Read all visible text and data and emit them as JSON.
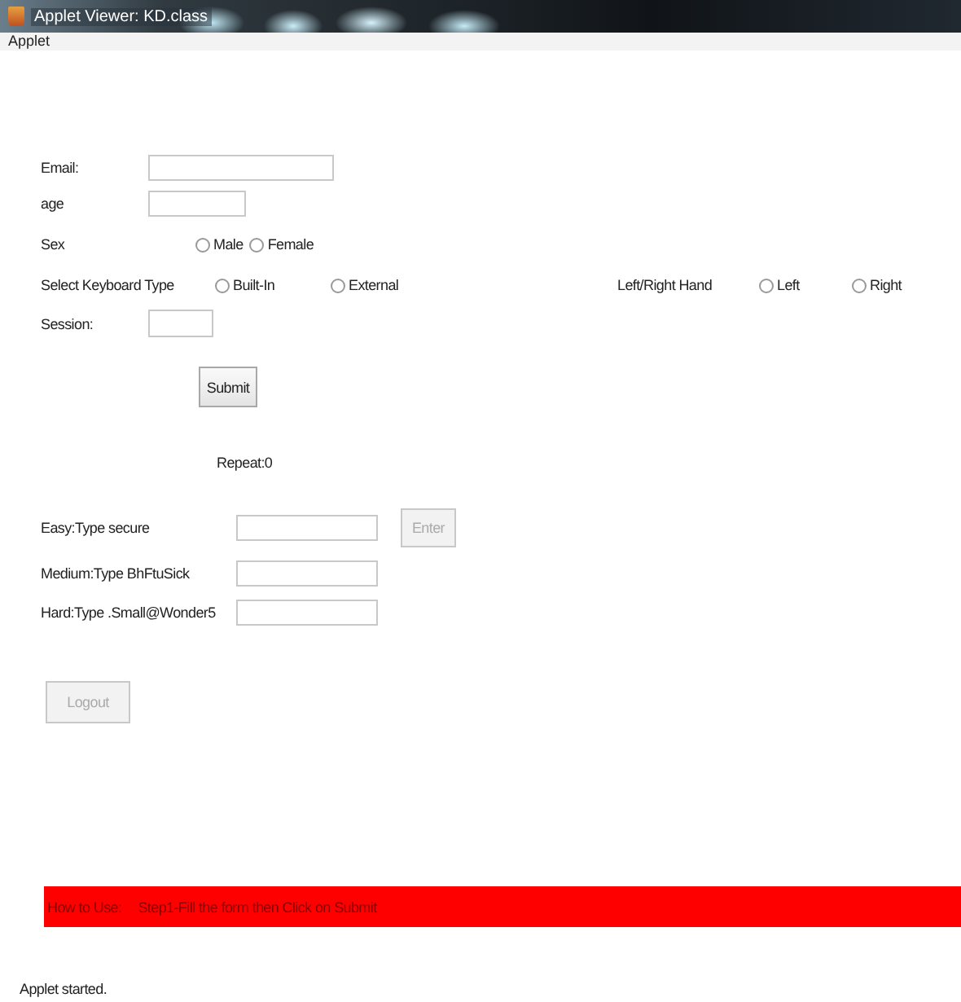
{
  "window": {
    "title": "Applet Viewer: KD.class"
  },
  "menu_bar": [
    "Applet"
  ],
  "form": {
    "email": {
      "label": "Email:"
    },
    "age": {
      "label": "age"
    },
    "sex": {
      "label": "Sex",
      "options": [
        {
          "label": "Male",
          "selected": false
        },
        {
          "label": "Female",
          "selected": false
        }
      ]
    },
    "keyboard": {
      "label": "Select Keyboard Type",
      "options": [
        {
          "label": "Built-In",
          "selected": false
        },
        {
          "label": "External",
          "selected": false
        }
      ]
    },
    "hand": {
      "label": "Left/Right Hand",
      "options": [
        {
          "label": "Left",
          "selected": false
        },
        {
          "label": "Right",
          "selected": false
        }
      ]
    },
    "session": {
      "label": "Session:"
    },
    "submit": {
      "label": "Submit",
      "disabled": false
    }
  },
  "repeat": "Repeat:0",
  "tests": [
    {
      "label": "Easy:Type  secure"
    },
    {
      "label": "Medium:Type  BhFtuSick"
    },
    {
      "label": "Hard:Type  .Small@Wonder5"
    }
  ],
  "enter_button": {
    "label": "Enter",
    "disabled": true
  },
  "logout_button": {
    "label": "Logout",
    "disabled": true
  },
  "help_bar": {
    "heading": "How to Use:",
    "text": "Step1-Fill the form then Click on Submit"
  },
  "status": "Applet started."
}
